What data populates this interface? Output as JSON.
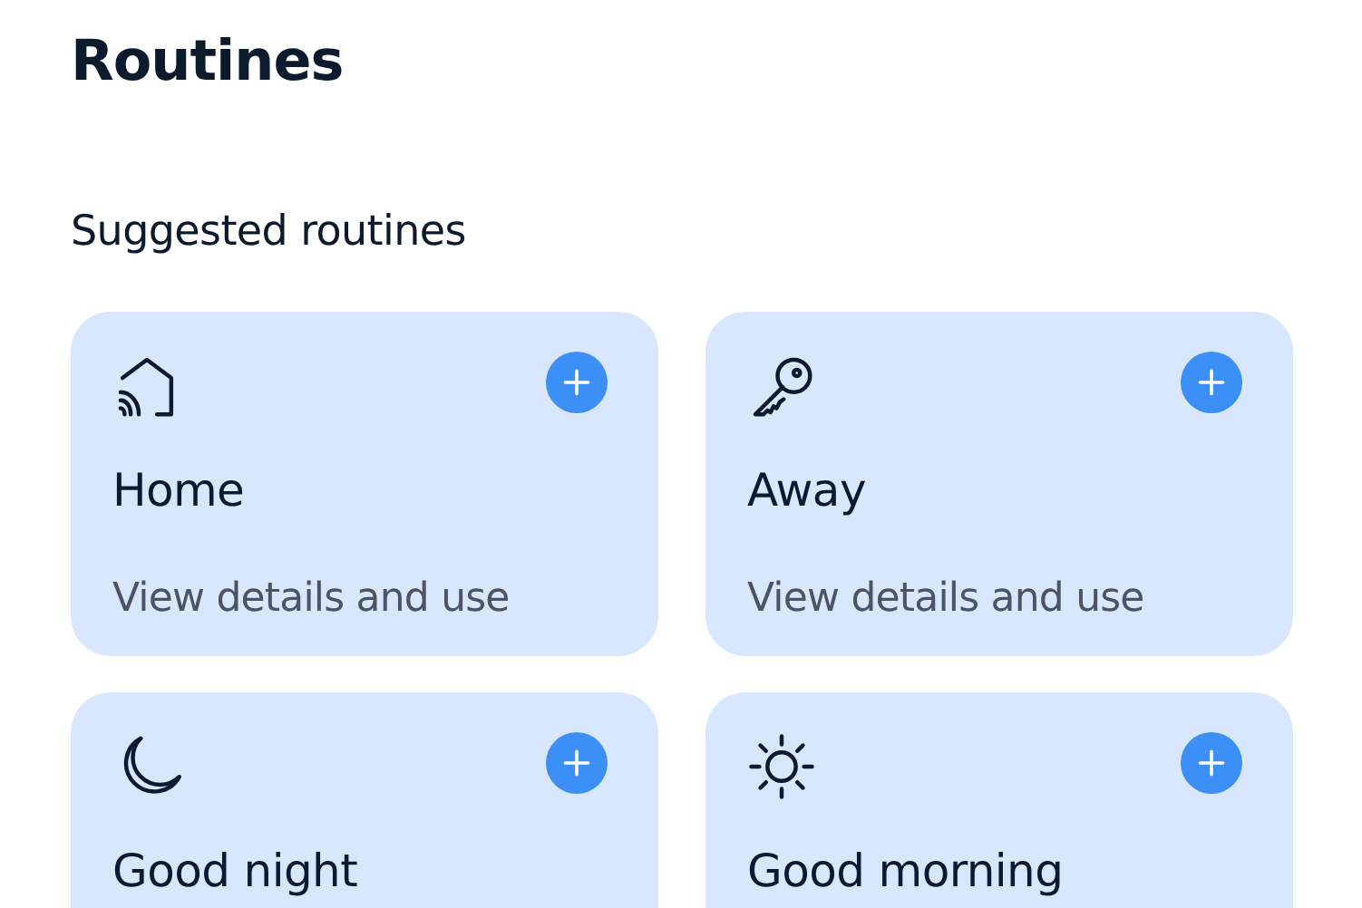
{
  "page": {
    "title": "Routines"
  },
  "section": {
    "title": "Suggested routines"
  },
  "routines": [
    {
      "title": "Home",
      "subtitle": "View details and use"
    },
    {
      "title": "Away",
      "subtitle": "View details and use"
    },
    {
      "title": "Good night"
    },
    {
      "title": "Good morning"
    }
  ]
}
